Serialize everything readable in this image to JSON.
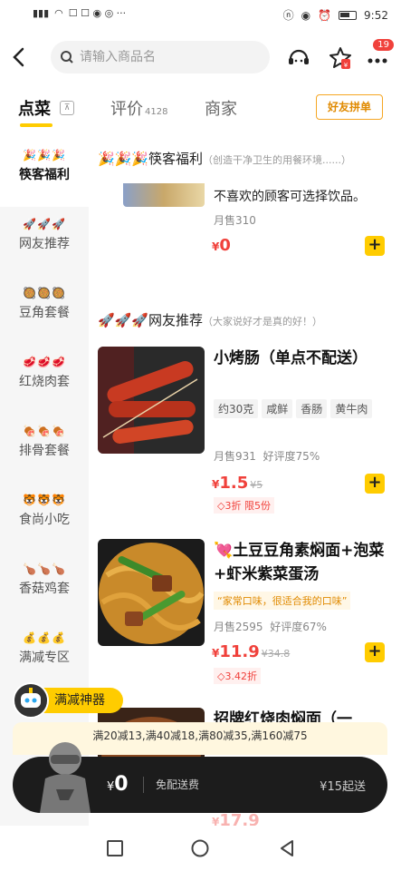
{
  "status_bar": {
    "time": "9:52",
    "left_text": "⁴⁶ᴵˡ"
  },
  "search": {
    "placeholder": "请输入商品名"
  },
  "header": {
    "badge_count": "19"
  },
  "tabs": {
    "order": "点菜",
    "reviews": "评价",
    "reviews_count": "4128",
    "merchant": "商家",
    "share_button": "好友拼单"
  },
  "sidebar": {
    "items": [
      {
        "label": "筷客福利",
        "emoji": "🎉🎉🎉"
      },
      {
        "label": "网友推荐",
        "emoji": "🚀🚀🚀"
      },
      {
        "label": "豆角套餐",
        "emoji": "🥘🥘🥘"
      },
      {
        "label": "红烧肉套",
        "emoji": "🥩🥩🥩"
      },
      {
        "label": "排骨套餐",
        "emoji": "🍖🍖🍖"
      },
      {
        "label": "食尚小吃",
        "emoji": "🐯🐯🐯"
      },
      {
        "label": "香菇鸡套",
        "emoji": "🍗🍗🍗"
      },
      {
        "label": "满减专区",
        "emoji": "💰💰💰"
      }
    ]
  },
  "sections": {
    "welfare_title": "🎉🎉🎉筷客福利",
    "welfare_sub": "（创造干净卫生的用餐环境......）",
    "welfare_item": {
      "desc": "不喜欢的顾客可选择饮品。",
      "sales": "月售310",
      "price_yen": "¥",
      "price": "0"
    },
    "recommend_title": "🚀🚀🚀网友推荐",
    "recommend_sub": "（大家说好才是真的好！）"
  },
  "items": [
    {
      "name": "小烤肠（单点不配送）",
      "tags": [
        "约30克",
        "咸鲜",
        "香肠",
        "黄牛肉"
      ],
      "sales": "月售931",
      "rating": "好评度75%",
      "price_yen": "¥",
      "price": "1.5",
      "orig_price": "¥5",
      "discount": "3折 限5份"
    },
    {
      "name": "💘土豆豆角素焖面+泡菜+虾米紫菜蛋汤",
      "quote": "“家常口味，很适合我的口味”",
      "sales": "月售2595",
      "rating": "好评度67%",
      "price_yen": "¥",
      "price": "11.9",
      "orig_price": "¥34.8",
      "discount": "3.42折"
    },
    {
      "name": "招牌红烧肉焖面（一",
      "price_yen": "¥",
      "price": "17.9"
    }
  ],
  "helper": {
    "label": "满减神器"
  },
  "promo": {
    "text": "满20减13,满40减18,满80减35,满160减75"
  },
  "cart": {
    "price_yen": "¥",
    "price": "0",
    "shipping": "免配送费",
    "minimum": "¥15起送"
  }
}
